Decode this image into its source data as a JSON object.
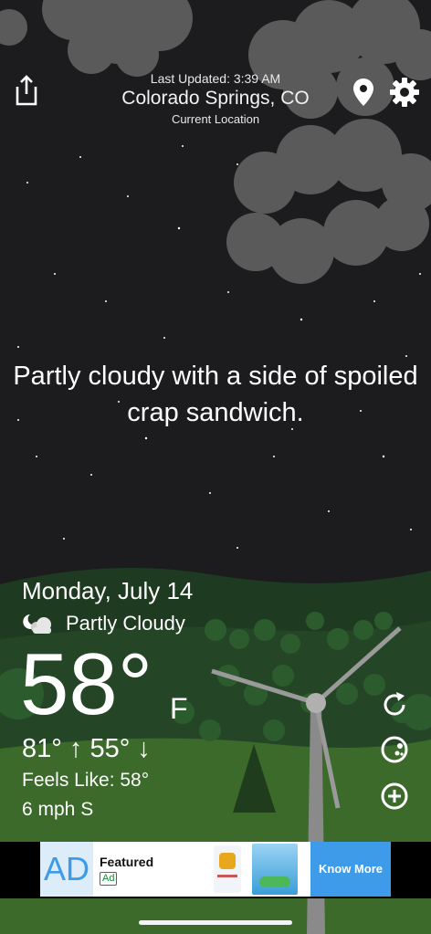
{
  "header": {
    "last_updated": "Last Updated: 3:39 AM",
    "city": "Colorado Springs, CO",
    "location_label": "Current Location"
  },
  "tagline": "Partly cloudy with a side of spoiled crap sandwich.",
  "weather": {
    "date": "Monday, July 14",
    "condition": "Partly Cloudy",
    "temperature": "58°",
    "unit": "F",
    "high": "81°",
    "low": "55°",
    "feels_like": "Feels Like: 58°",
    "wind": "6 mph S"
  },
  "icons": {
    "share": "share-icon",
    "location": "location-pin-icon",
    "settings": "gear-icon",
    "condition": "partly-cloudy-night-icon",
    "refresh": "refresh-icon",
    "moon": "moon-phase-icon",
    "add": "add-circle-icon"
  },
  "ad": {
    "logo_text": "AD",
    "featured": "Featured",
    "badge": "Ad",
    "cta": "Know More"
  },
  "colors": {
    "sky": "#1c1c1e",
    "grass": "#3b6a2a",
    "hills": "#1e3a20",
    "ad_accent": "#3d9be9"
  }
}
